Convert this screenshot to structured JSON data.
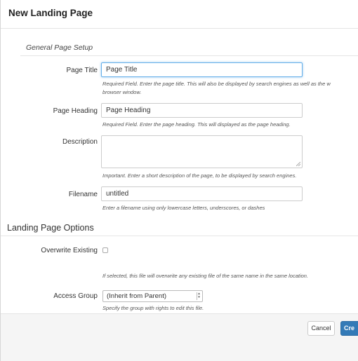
{
  "header": {
    "title": "New Landing Page"
  },
  "general": {
    "section_title": "General Page Setup",
    "page_title": {
      "label": "Page Title",
      "value": "Page Title",
      "help_line1": "Required Field. Enter the page title. This will also be displayed by search engines as well as the w",
      "help_line2": "browser window."
    },
    "page_heading": {
      "label": "Page Heading",
      "value": "Page Heading",
      "help": "Required Field. Enter the page heading. This will displayed as the page heading."
    },
    "description": {
      "label": "Description",
      "value": "",
      "help": "Important. Enter a short description of the page, to be displayed by search engines."
    },
    "filename": {
      "label": "Filename",
      "value": "untitled",
      "help": "Enter a filename using only lowercase letters, underscores, or dashes"
    }
  },
  "landing": {
    "section_title": "Landing Page Options",
    "overwrite": {
      "label": "Overwrite Existing",
      "checked": false,
      "help": "If selected, this file will overwrite any existing file of the same name in the same location."
    },
    "access_group": {
      "label": "Access Group",
      "selected": "(Inherit from Parent)",
      "help": "Specify the group with rights to edit this file."
    }
  },
  "footer": {
    "cancel_label": "Cancel",
    "create_label": "Cre"
  },
  "colors": {
    "primary": "#337ab7",
    "focus": "#66afe9"
  }
}
